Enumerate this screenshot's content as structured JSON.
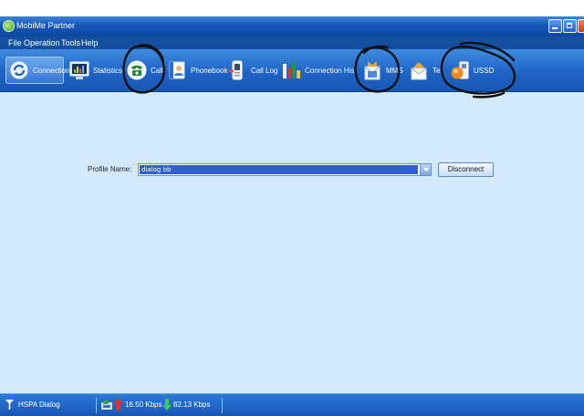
{
  "window": {
    "title": "MobiMe Partner"
  },
  "menu": [
    {
      "label": "File"
    },
    {
      "label": "Operation"
    },
    {
      "label": "Tools"
    },
    {
      "label": "Help"
    }
  ],
  "toolbar": [
    {
      "label": "Connection",
      "icon": "connection-icon"
    },
    {
      "label": "Statistics",
      "icon": "statistics-icon"
    },
    {
      "label": "Call",
      "icon": "phone-icon"
    },
    {
      "label": "Phonebook",
      "icon": "phonebook-icon"
    },
    {
      "label": "Call Log",
      "icon": "call-log-icon"
    },
    {
      "label": "Connection History",
      "icon": "bar-chart-icon"
    },
    {
      "label": "MMS",
      "icon": "mms-icon"
    },
    {
      "label": "Text",
      "icon": "envelope-icon"
    },
    {
      "label": "USSD",
      "icon": "ussd-icon"
    }
  ],
  "profile": {
    "label": "Profile Name:",
    "value": "dialog bb"
  },
  "disconnect_label": "Disconnect",
  "status": {
    "network": "HSPA Dialog",
    "upload": "16.50 Kbps",
    "download": "82.13 Kbps"
  },
  "colors": {
    "toolbar": "#1e63c6",
    "workspace": "#d2eafb",
    "selection": "#2f5fd0"
  }
}
